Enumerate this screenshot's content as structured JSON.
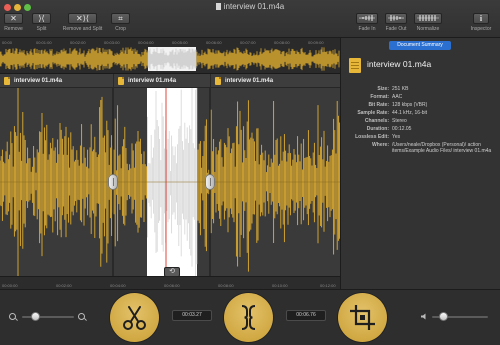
{
  "window": {
    "title": "interview 01.m4a"
  },
  "colors": {
    "accent": "#e7b73a",
    "waveform": "#e0ae2f",
    "selection": "#ffffff",
    "summary_tab": "#2b6fd1"
  },
  "toolbar": {
    "buttons": [
      {
        "label": "Remove",
        "icon": "remove-icon"
      },
      {
        "label": "Split",
        "icon": "split-icon"
      },
      {
        "label": "Remove and Split",
        "icon": "remove-and-split-icon"
      },
      {
        "label": "Crop",
        "icon": "crop-icon"
      },
      {
        "label": "Fade In",
        "icon": "fade-in-icon"
      },
      {
        "label": "Fade Out",
        "icon": "fade-out-icon"
      },
      {
        "label": "Normalize",
        "icon": "normalize-icon"
      },
      {
        "label": "Inspector",
        "icon": "info-icon"
      }
    ]
  },
  "overview": {
    "ticks": [
      "00:00",
      "00:01:00",
      "00:02:00",
      "00:03:00",
      "00:04:00",
      "00:05:00",
      "00:06:00",
      "00:07:00",
      "00:08:00",
      "00:09:00"
    ]
  },
  "segments": [
    {
      "name": "interview 01.m4a"
    },
    {
      "name": "interview 01.m4a"
    },
    {
      "name": "interview 01.m4a"
    }
  ],
  "editor": {
    "ruler_ticks": [
      "00:00:00",
      "00:02:00",
      "00:04:00",
      "00:06:00",
      "00:08:00",
      "00:10:00",
      "00:12:00"
    ]
  },
  "summary": {
    "tab_label": "Document Summary",
    "file_name": "interview 01.m4a",
    "rows": [
      {
        "key": "Size:",
        "value": "251 KB"
      },
      {
        "key": "Format:",
        "value": "AAC"
      },
      {
        "key": "Bit Rate:",
        "value": "128 kbps (VBR)"
      },
      {
        "key": "Sample Rate:",
        "value": "44.1 kHz, 16-bit"
      },
      {
        "key": "Channels:",
        "value": "Stereo"
      },
      {
        "key": "Duration:",
        "value": "00:12.05"
      },
      {
        "key": "Lossless Edit:",
        "value": "Yes"
      },
      {
        "key": "Where:",
        "value": "/Users/neale/Dropbox (Personal)/ action items/Example Audio Files/ interview 01.m4a"
      }
    ]
  },
  "bottombar": {
    "zoom_level": 0.25,
    "volume_level": 0.2,
    "selection_start": "00:03.27",
    "selection_end": "00:06.76",
    "big_buttons": [
      "scissors-icon",
      "split-icon",
      "crop-icon"
    ]
  }
}
